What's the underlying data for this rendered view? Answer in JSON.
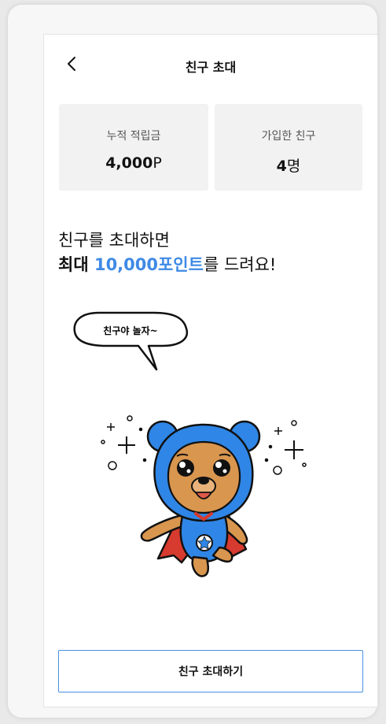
{
  "header": {
    "title": "친구 초대"
  },
  "stats": [
    {
      "label": "누적 적립금",
      "value": "4,000",
      "unit": "P"
    },
    {
      "label": "가입한 친구",
      "value": "4",
      "unit": "명"
    }
  ],
  "promo": {
    "line1": "친구를 초대하면",
    "line2_prefix": "최대 ",
    "line2_highlight": "10,000포인트",
    "line2_suffix": "를 드려요!"
  },
  "illustration": {
    "speech_bubble": "친구야 놀자~"
  },
  "cta": {
    "label": "친구 초대하기"
  },
  "colors": {
    "accent": "#3f8ae6",
    "hood": "#2f86e6",
    "bear": "#d9964f",
    "cape": "#d73a2e"
  }
}
